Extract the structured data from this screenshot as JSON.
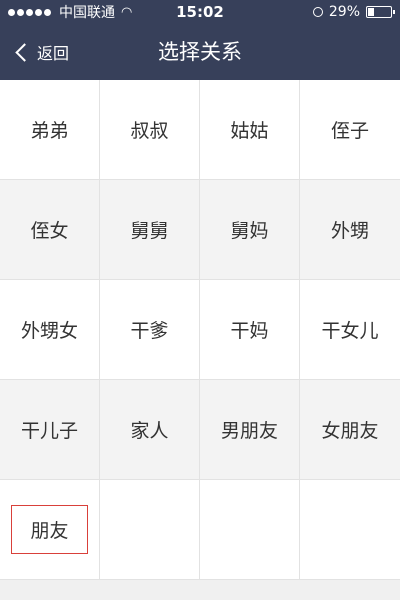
{
  "status_bar": {
    "carrier": "中国联通",
    "time": "15:02",
    "battery_percent": "29%",
    "battery_level": 0.29,
    "icons": [
      "signal-dots-icon",
      "wifi-icon",
      "alarm-icon",
      "battery-icon"
    ]
  },
  "nav": {
    "back_label": "返回",
    "title": "选择关系"
  },
  "colors": {
    "nav_background": "#37405a",
    "selected_border": "#d9403a"
  },
  "grid": {
    "selected": "朋友",
    "rows": [
      [
        "弟弟",
        "叔叔",
        "姑姑",
        "侄子"
      ],
      [
        "侄女",
        "舅舅",
        "舅妈",
        "外甥"
      ],
      [
        "外甥女",
        "干爹",
        "干妈",
        "干女儿"
      ],
      [
        "干儿子",
        "家人",
        "男朋友",
        "女朋友"
      ],
      [
        "朋友",
        "",
        "",
        ""
      ]
    ]
  }
}
